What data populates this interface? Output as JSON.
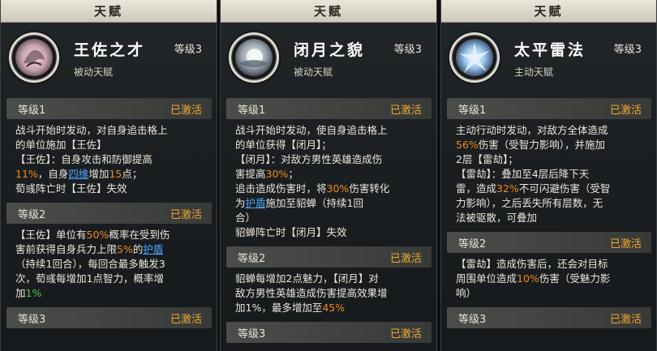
{
  "panels": [
    {
      "header": "天赋",
      "name": "王佐之才",
      "level": "等级3",
      "type": "被动天赋",
      "levels": [
        {
          "label": "等级1",
          "status": "已激活",
          "lines": [
            [
              {
                "t": "战斗开始时发动，对自身追击格上"
              }
            ],
            [
              {
                "t": "的单位施加【王佐】"
              }
            ],
            [
              {
                "t": "【王佐】：自身攻击和防御提高"
              }
            ],
            [
              {
                "t": "11%",
                "c": "o"
              },
              {
                "t": "，自身"
              },
              {
                "t": "四维",
                "c": "b"
              },
              {
                "t": "增加"
              },
              {
                "t": "15",
                "c": "o"
              },
              {
                "t": "点；"
              }
            ],
            [
              {
                "t": "荀彧阵亡时【王佐】失效"
              }
            ]
          ]
        },
        {
          "label": "等级2",
          "status": "已激活",
          "lines": [
            [
              {
                "t": "【王佐】单位有"
              },
              {
                "t": "50%",
                "c": "o"
              },
              {
                "t": "概率在受到伤"
              }
            ],
            [
              {
                "t": "害前获得自身兵力上限"
              },
              {
                "t": "5%",
                "c": "o"
              },
              {
                "t": "的"
              },
              {
                "t": "护盾",
                "c": "b"
              }
            ],
            [
              {
                "t": "（持续1回合），每回合最多触发3"
              }
            ],
            [
              {
                "t": "次，荀彧每增加1点智力，概率增"
              }
            ],
            [
              {
                "t": "加"
              },
              {
                "t": "1%",
                "c": "g"
              }
            ]
          ]
        },
        {
          "label": "等级3",
          "status": "已激活",
          "lines": []
        }
      ]
    },
    {
      "header": "天赋",
      "name": "闭月之貌",
      "level": "等级3",
      "type": "被动天赋",
      "levels": [
        {
          "label": "等级1",
          "status": "已激活",
          "lines": [
            [
              {
                "t": "战斗开始时发动，使自身追击格上"
              }
            ],
            [
              {
                "t": "的单位获得【闭月】；"
              }
            ],
            [
              {
                "t": "【闭月】：对敌方男性英雄造成伤"
              }
            ],
            [
              {
                "t": "害提高"
              },
              {
                "t": "30%",
                "c": "o"
              },
              {
                "t": "；"
              }
            ],
            [
              {
                "t": "追击造成伤害时，将"
              },
              {
                "t": "30%",
                "c": "o"
              },
              {
                "t": "伤害转化"
              }
            ],
            [
              {
                "t": "为"
              },
              {
                "t": "护盾",
                "c": "b"
              },
              {
                "t": "施加至貂蝉（持续1回"
              }
            ],
            [
              {
                "t": "合）"
              }
            ],
            [
              {
                "t": "貂蝉阵亡时【闭月】失效"
              }
            ]
          ]
        },
        {
          "label": "等级2",
          "status": "已激活",
          "lines": [
            [
              {
                "t": "貂蝉每增加2点魅力，【闭月】对"
              }
            ],
            [
              {
                "t": "敌方男性英雄造成伤害提高效果增"
              }
            ],
            [
              {
                "t": "加1%，最多增加至"
              },
              {
                "t": "45%",
                "c": "o"
              }
            ]
          ]
        },
        {
          "label": "等级3",
          "status": "已激活",
          "lines": []
        }
      ]
    },
    {
      "header": "天赋",
      "name": "太平雷法",
      "level": "等级3",
      "type": "主动天赋",
      "levels": [
        {
          "label": "等级1",
          "status": "已激活",
          "lines": [
            [
              {
                "t": "主动行动时发动，对敌方全体造成"
              }
            ],
            [
              {
                "t": "56%",
                "c": "o"
              },
              {
                "t": "伤害（受智力影响），并施加"
              }
            ],
            [
              {
                "t": "2层【雷劫】；"
              }
            ],
            [
              {
                "t": "【雷劫】：叠加至4层后降下天"
              }
            ],
            [
              {
                "t": "雷，造成"
              },
              {
                "t": "32%",
                "c": "o"
              },
              {
                "t": "不可闪避伤害（受智"
              }
            ],
            [
              {
                "t": "力影响），之后丢失所有层数，无"
              }
            ],
            [
              {
                "t": "法被驱散，可叠加"
              }
            ]
          ]
        },
        {
          "label": "等级2",
          "status": "已激活",
          "lines": [
            [
              {
                "t": "【雷劫】造成伤害后，还会对目标"
              }
            ],
            [
              {
                "t": "周围单位造成"
              },
              {
                "t": "10%",
                "c": "o"
              },
              {
                "t": "伤害（受魅力影"
              }
            ],
            [
              {
                "t": "响）"
              }
            ]
          ]
        },
        {
          "label": "等级3",
          "status": "已激活",
          "lines": []
        }
      ]
    }
  ],
  "colors": {
    "status": "#f0a830",
    "highlight_number": "#f08a1e",
    "keyword_link": "#4da8ff",
    "highlight_green": "#4fc84a"
  },
  "icons": [
    "wangzuo-talent-icon",
    "biyue-talent-icon",
    "taiping-leifa-talent-icon"
  ]
}
